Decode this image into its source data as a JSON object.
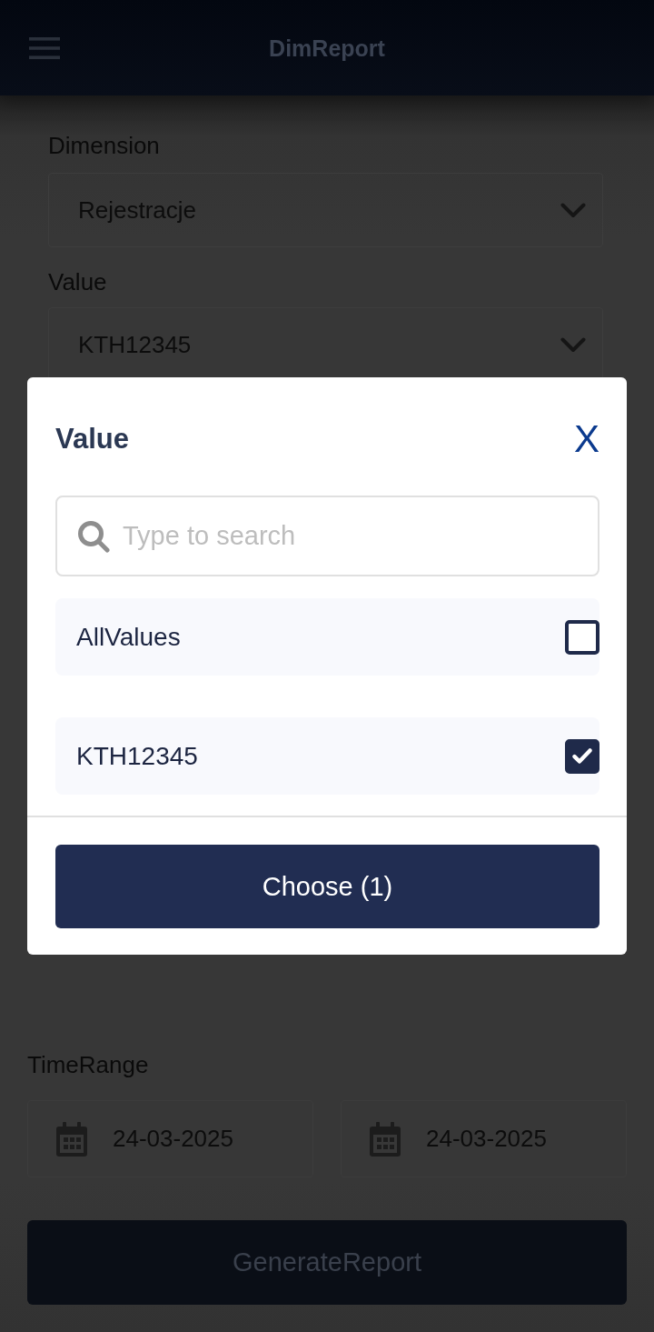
{
  "header": {
    "title": "DimReport"
  },
  "form": {
    "fields": [
      {
        "label": "Dimension",
        "value": "Rejestracje"
      },
      {
        "label": "Value",
        "value": "KTH12345"
      }
    ],
    "time_range": {
      "label": "TimeRange",
      "dates": [
        "24-03-2025",
        "24-03-2025"
      ]
    },
    "generate_button": "GenerateReport"
  },
  "dialog": {
    "title": "Value",
    "close": "X",
    "search": {
      "placeholder": "Type to search"
    },
    "options": [
      {
        "label": "AllValues",
        "checked": false
      },
      {
        "label": "KTH12345",
        "checked": true
      }
    ],
    "button": "Choose (1)"
  }
}
